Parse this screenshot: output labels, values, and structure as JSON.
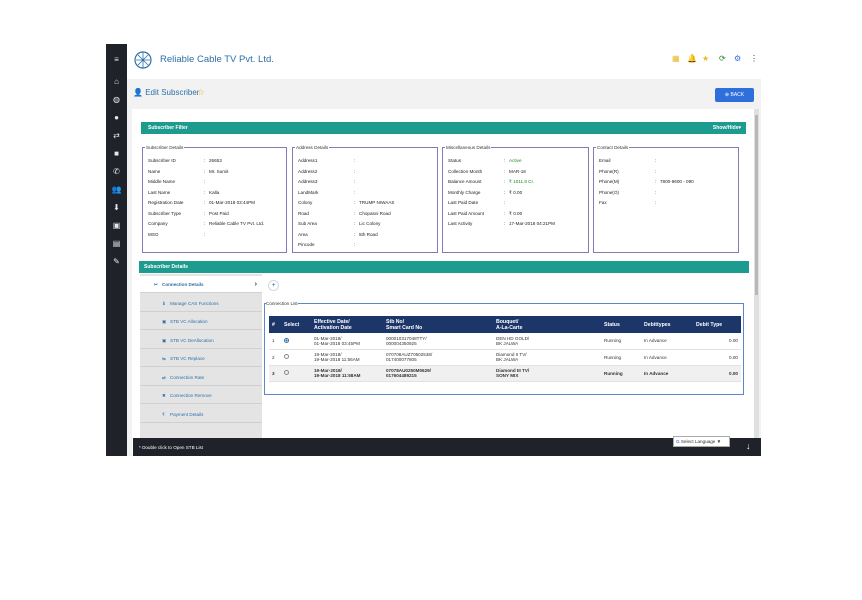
{
  "app": {
    "brand": "Reliable Cable TV Pvt. Ltd."
  },
  "sidebar": {
    "icons": [
      "≡",
      "⌂",
      "◍",
      "●",
      "⇄",
      "■",
      "✆",
      "👥",
      "⬇",
      "▣",
      "▤",
      "✎"
    ],
    "icon_names": [
      "hamburger-icon",
      "home-icon",
      "globe-icon",
      "user-icon",
      "transfer-icon",
      "box-icon",
      "phone-icon",
      "users-icon",
      "download-icon",
      "tv-icon",
      "report-icon",
      "wrench-icon"
    ]
  },
  "topbar": {
    "icons": [
      "▦",
      "🔔",
      "★",
      "⟳",
      "⚙",
      "⋮"
    ],
    "icon_colors": [
      "#e8b82a",
      "#2e6fdc",
      "#e8b82a",
      "#1a8a2a",
      "#2e6fdc",
      "#333333"
    ]
  },
  "page": {
    "title": "Edit Subscriber",
    "star": "☆",
    "back": "BACK"
  },
  "filter": {
    "title": "Subscriber Filter",
    "show_hide": "Show/Hide▾"
  },
  "subscriber_details": {
    "legend": "Subscriber Details",
    "rows": [
      [
        "Subscriber ID",
        ":",
        "26653"
      ],
      [
        "Name",
        ":",
        "Mr. Sumit"
      ],
      [
        "Middle Name",
        ":",
        ""
      ],
      [
        "Last Name",
        ":",
        "Kalla"
      ],
      [
        "Registration Date",
        ":",
        "01-Mar-2018 03:44PM"
      ],
      [
        "Subscriber Type",
        ":",
        "Post Paid"
      ],
      [
        "Company",
        ":",
        "Reliable Cable TV Pvt. Ltd."
      ],
      [
        "MSO",
        ":",
        ""
      ]
    ]
  },
  "address_details": {
    "legend": "Address Details",
    "rows": [
      [
        "Address1",
        ":",
        ""
      ],
      [
        "Address2",
        ":",
        ""
      ],
      [
        "Address3",
        ":",
        ""
      ],
      [
        "LandMark",
        ":",
        ""
      ],
      [
        "Colony",
        ":",
        "TRUMP NIWAAS"
      ],
      [
        "Road",
        ":",
        "Chopasni Road"
      ],
      [
        "Sub Area",
        ":",
        "Lic Colony"
      ],
      [
        "Area",
        ":",
        "5th Road"
      ],
      [
        "Pincode",
        ":",
        ""
      ]
    ]
  },
  "misc_details": {
    "legend": "Miscellaneous Details",
    "rows": [
      [
        "Status",
        ":",
        "Active"
      ],
      [
        "Collection Month",
        ":",
        "MAR-18"
      ],
      [
        "Balance Amount",
        ":",
        "₹ 1011.8 Cr."
      ],
      [
        "Monthly Charge",
        ":",
        "₹ 0.00"
      ],
      [
        "Last Paid Date",
        ":",
        ""
      ],
      [
        "Last Paid Amount",
        ":",
        "₹ 0.00"
      ],
      [
        "Last Activity",
        ":",
        "17-Mar-2018 04:21PM"
      ]
    ]
  },
  "contact_details": {
    "legend": "Contact Details",
    "rows": [
      [
        "Email",
        ":",
        ""
      ],
      [
        "Phone(R)",
        ":",
        ""
      ],
      [
        "Phone(M)",
        ":",
        "7800-9600 - 090"
      ],
      [
        "Phone(O)",
        ":",
        ""
      ],
      [
        "Fax",
        ":",
        ""
      ]
    ]
  },
  "subscriber_section": {
    "title": "Subscriber Details"
  },
  "menu": {
    "items": [
      {
        "icon": "✂",
        "label": "Connection Details"
      },
      {
        "icon": "⬇",
        "label": "Manage CAS Functions"
      },
      {
        "icon": "▣",
        "label": "STB VC Allocation"
      },
      {
        "icon": "▣",
        "label": "STB VC DeAllocation"
      },
      {
        "icon": "⇆",
        "label": "STB VC Replace"
      },
      {
        "icon": "⇄",
        "label": "Connection Rate"
      },
      {
        "icon": "✖",
        "label": "Connection Remove"
      },
      {
        "icon": "₹",
        "label": "Payment Details"
      }
    ],
    "chevron": "›"
  },
  "connection_list": {
    "legend": "Connection List",
    "plus": "+",
    "headers": [
      "#",
      "Select",
      "Effective Date/\nActivation Date",
      "Stb No/\nSmart Card No",
      "Bouquet/\nA-La-Carte",
      "Status",
      "Debittypes",
      "Debit Type"
    ],
    "rows": [
      {
        "n": "1",
        "selected": true,
        "date1": "01-Mar-2018/",
        "date2": "01-Mar-2018 03:45PM",
        "stb1": "000010317048TTY/",
        "stb2": "000004350925",
        "b1": "DEN HD GOLD/",
        "b2": "BK JALWA",
        "status": "Running",
        "debit": "In Advance",
        "amt": "0.00",
        "bold": false
      },
      {
        "n": "2",
        "selected": false,
        "date1": "19-Mar-2018/",
        "date2": "19-Mar-2018 11:56AM",
        "stb1": "070708AUZ70502538/",
        "stb2": "017400077805",
        "b1": "Diamond II TV/",
        "b2": "BK JALWA",
        "status": "Running",
        "debit": "In Advance",
        "amt": "0.00",
        "bold": false
      },
      {
        "n": "3",
        "selected": false,
        "date1": "19-Mar-2018/",
        "date2": "19-Mar-2018 11:58AM",
        "stb1": "07078AU0250M0629/",
        "stb2": "017604489215",
        "b1": "Diamond III TV/",
        "b2": "SONY MIX",
        "status": "Running",
        "debit": "In Advance",
        "amt": "0.00",
        "bold": true
      }
    ]
  },
  "footer": {
    "hint": "* Double click to Open STB List",
    "language": "Select Language ▼",
    "arrow": "↓"
  }
}
